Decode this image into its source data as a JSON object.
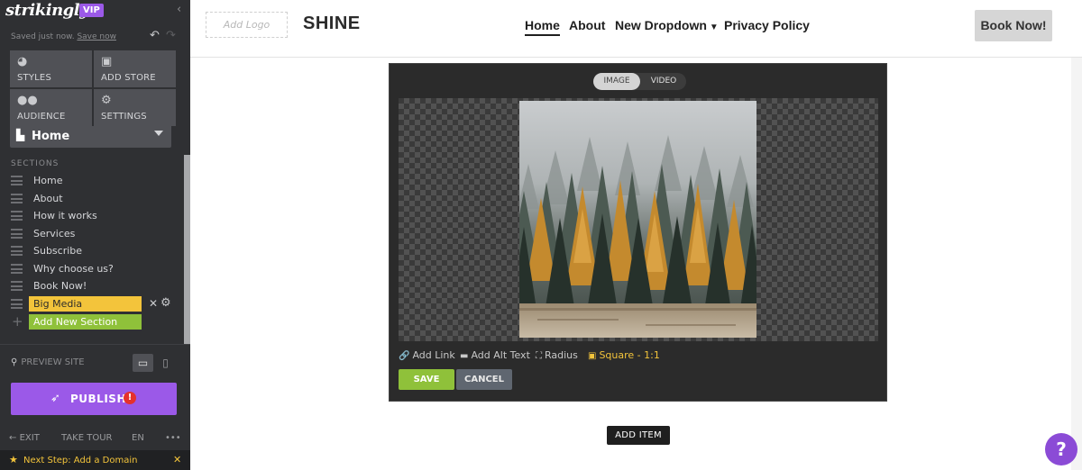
{
  "app": {
    "logo": "strikingly",
    "badge": "VIP",
    "saved_text": "Saved just now.",
    "save_now": "Save now"
  },
  "toolbar": {
    "tiles": [
      {
        "label": "STYLES",
        "icon": "palette-icon"
      },
      {
        "label": "ADD STORE",
        "icon": "store-icon"
      },
      {
        "label": "AUDIENCE",
        "icon": "users-icon"
      },
      {
        "label": "SETTINGS",
        "icon": "gear-icon"
      }
    ]
  },
  "page_select": {
    "value": "Home"
  },
  "sections": {
    "title": "SECTIONS",
    "items": [
      "Home",
      "About",
      "How it works",
      "Services",
      "Subscribe",
      "Why choose us?",
      "Book Now!"
    ],
    "active": "Big Media",
    "add_label": "Add New Section"
  },
  "footer": {
    "preview": "PREVIEW SITE",
    "publish": "PUBLISH",
    "publish_alert": "!",
    "exit": "EXIT",
    "tour": "TAKE TOUR",
    "lang": "EN",
    "more": "•••",
    "next_step": "Next Step: Add a Domain"
  },
  "site": {
    "add_logo": "Add Logo",
    "brand": "SHINE",
    "nav": [
      "Home",
      "About",
      "New Dropdown",
      "Privacy Policy"
    ],
    "cta": "Book Now!"
  },
  "editor": {
    "tabs": [
      "IMAGE",
      "VIDEO"
    ],
    "active_tab": "IMAGE",
    "tools": {
      "add_link": "Add Link",
      "alt_text": "Add Alt Text",
      "radius": "Radius",
      "ratio": "Square - 1:1"
    },
    "save": "SAVE",
    "cancel": "CANCEL"
  },
  "add_item": "ADD ITEM",
  "help": "?",
  "colors": {
    "sidebar_bg": "#2f3033",
    "vip": "#9b59e8",
    "active_section": "#f3c43b",
    "add_section": "#8fc13a",
    "publish": "#9b59e8",
    "alert": "#e5312c",
    "save": "#8fc13a",
    "ratio_active": "#f3c43b",
    "help": "#8b4bd6"
  }
}
